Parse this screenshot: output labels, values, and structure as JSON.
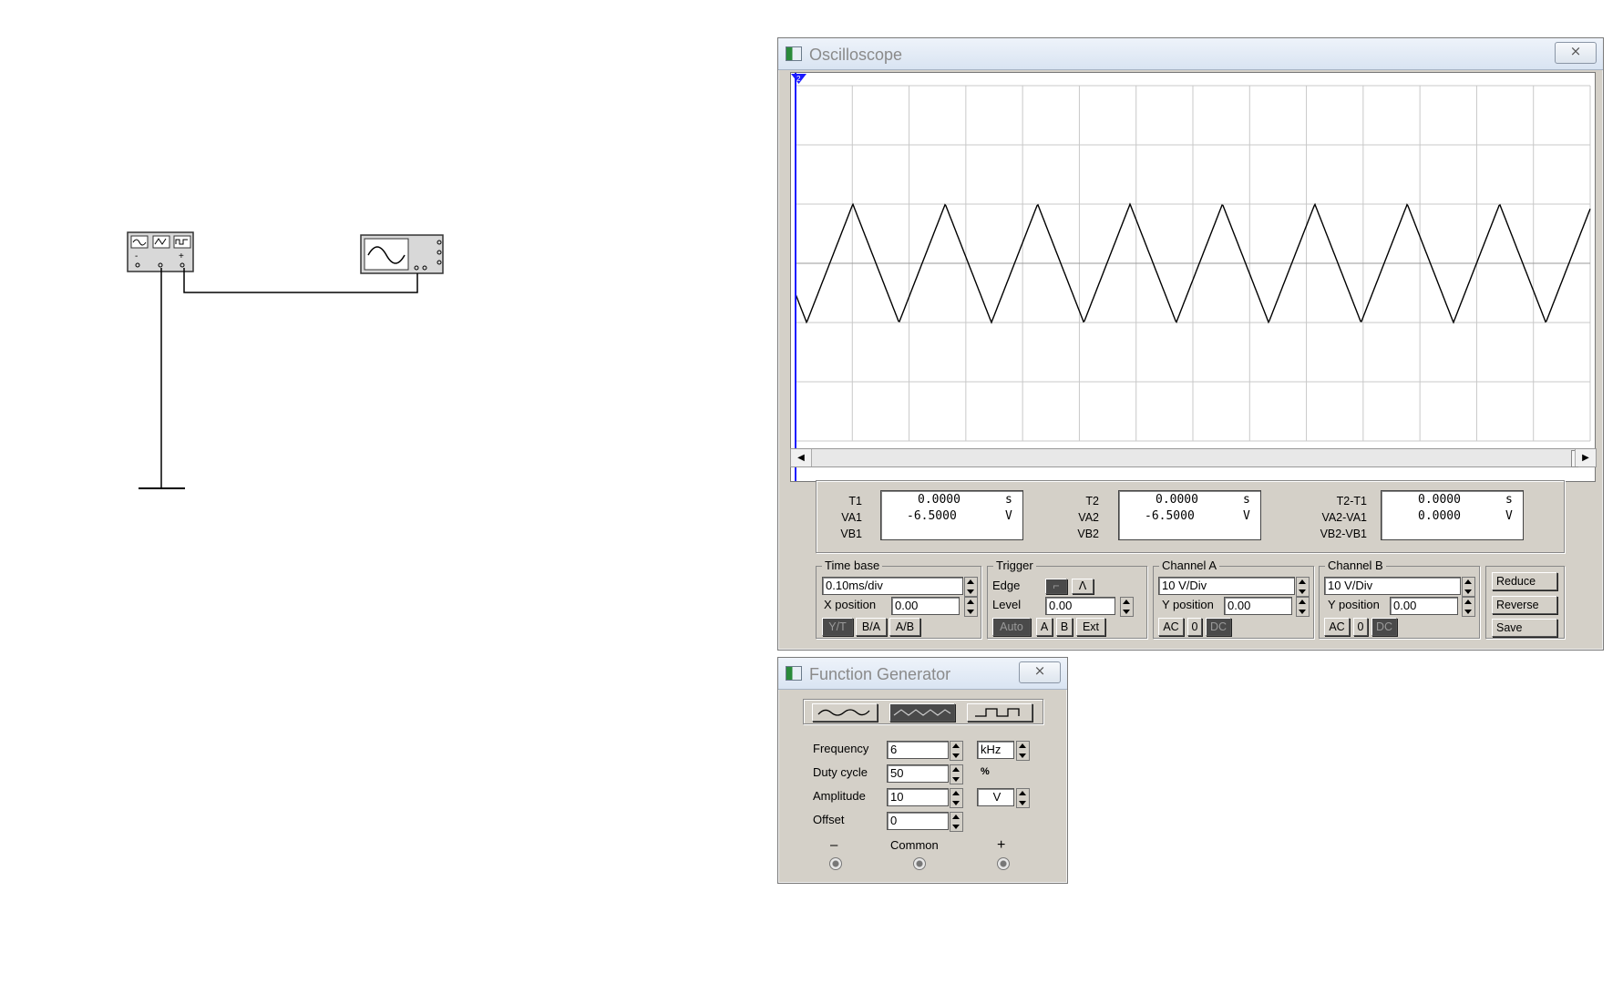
{
  "oscilloscope": {
    "title": "Oscilloscope",
    "close_label": "⨯",
    "trace_marker": "2",
    "readout": {
      "t1_label": "T1",
      "va1_label": "VA1",
      "vb1_label": "VB1",
      "t1_value": "0.0000",
      "t1_unit": "s",
      "va1_value": "-6.5000",
      "va1_unit": "V",
      "t2_label": "T2",
      "va2_label": "VA2",
      "vb2_label": "VB2",
      "t2_value": "0.0000",
      "t2_unit": "s",
      "va2_value": "-6.5000",
      "va2_unit": "V",
      "dt_label": "T2-T1",
      "dva_label": "VA2-VA1",
      "dvb_label": "VB2-VB1",
      "dt_value": "0.0000",
      "dt_unit": "s",
      "dva_value": "0.0000",
      "dva_unit": "V"
    },
    "timebase": {
      "title": "Time base",
      "scale": "0.10ms/div",
      "xpos_label": "X position",
      "xpos": "0.00",
      "yt": "Y/T",
      "ba": "B/A",
      "ab": "A/B"
    },
    "trigger": {
      "title": "Trigger",
      "edge_label": "Edge",
      "level_label": "Level",
      "level": "0.00",
      "auto": "Auto",
      "a": "A",
      "b": "B",
      "ext": "Ext"
    },
    "channel_a": {
      "title": "Channel A",
      "scale": "10 V/Div",
      "ypos_label": "Y position",
      "ypos": "0.00",
      "ac": "AC",
      "zero": "0",
      "dc": "DC"
    },
    "channel_b": {
      "title": "Channel B",
      "scale": "10 V/Div",
      "ypos_label": "Y position",
      "ypos": "0.00",
      "ac": "AC",
      "zero": "0",
      "dc": "DC"
    },
    "reduce": "Reduce",
    "reverse": "Reverse",
    "save": "Save"
  },
  "function_generator": {
    "title": "Function Generator",
    "close_label": "⨯",
    "waveforms": [
      "sine",
      "triangle",
      "square"
    ],
    "selected_waveform": "triangle",
    "frequency_label": "Frequency",
    "frequency": "6",
    "frequency_unit": "kHz",
    "duty_label": "Duty cycle",
    "duty": "50",
    "duty_unit": "%",
    "amplitude_label": "Amplitude",
    "amplitude": "10",
    "amplitude_unit": "V",
    "offset_label": "Offset",
    "offset": "0",
    "minus_label": "–",
    "common_label": "Common",
    "plus_label": "+"
  },
  "scope_signal": {
    "waveform": "triangle",
    "cycles_visible": 8.6,
    "peak_divisions": 1,
    "colors": {
      "trace": "#000000",
      "grid": "#c8c8c8",
      "cursor": "#1a1aff"
    }
  }
}
